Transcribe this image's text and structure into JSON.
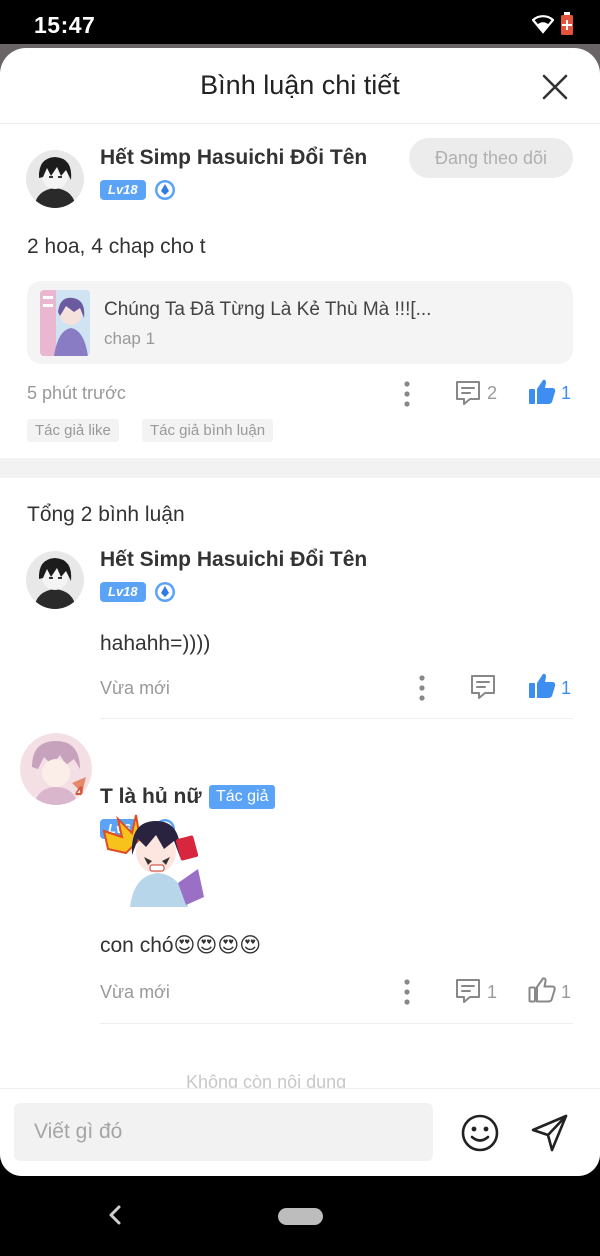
{
  "status_bar": {
    "time": "15:47"
  },
  "header": {
    "title": "Bình luận chi tiết"
  },
  "post": {
    "username": "Hết Simp Hasuichi Đổi Tên",
    "level": "Lv18",
    "follow_label": "Đang theo dõi",
    "text": "2 hoa, 4 chap cho t",
    "comic": {
      "title": "Chúng Ta Đã Từng Là Kẻ Thù Mà !!![...",
      "chapter": "chap 1"
    },
    "time": "5 phút trước",
    "reply_count": "2",
    "like_count": "1",
    "tags": [
      "Tác giả like",
      "Tác giả bình luận"
    ]
  },
  "replies_header": "Tổng 2 bình luận",
  "replies": [
    {
      "username": "Hết Simp Hasuichi Đổi Tên",
      "level": "Lv18",
      "text": "hahahh=))))",
      "time": "Vừa mới",
      "like_count": "1",
      "liked": true
    },
    {
      "username": "T là hủ nữ",
      "author_badge": "Tác giả",
      "level": "Lv6",
      "text": "con chó😍😍😍😍",
      "time": "Vừa mới",
      "reply_count": "1",
      "like_count": "1",
      "liked": false
    }
  ],
  "faded_text": "Không còn nội dung",
  "composer": {
    "placeholder": "Viết gì đó"
  },
  "colors": {
    "accent": "#3d8ef0",
    "badge": "#5aa3f7",
    "muted": "#999999"
  }
}
